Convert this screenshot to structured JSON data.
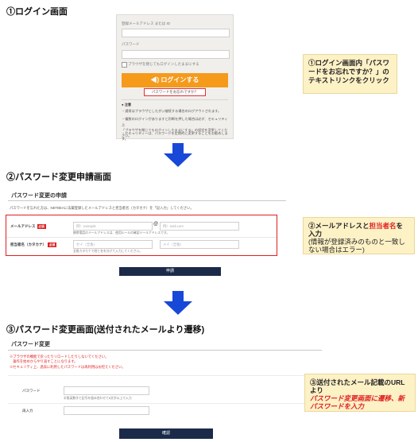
{
  "step1": {
    "title": "①ログイン画面",
    "login": {
      "email_label": "登録メールアドレス または ID",
      "password_label": "パスワード",
      "remember_label": "ブラウザを閉じてもログインしたままにする",
      "login_button": "◀) ログインする",
      "forgot_link": "パスワードをお忘れですか？",
      "notes_heading": "注意",
      "notes": [
        "・通常はブラウザとしたがい継続する場合のログアウトされます。",
        "・複数のログインがありますと判断を押した場合は必ず、セキュリティ上\n「ブラウザを閉じてもログインしたままにする」の設定を変更してください。",
        "・セキュリティーは、パスワードを定期的に変更することをお勧めします。"
      ]
    },
    "callout": "①ログイン画面内「パスワードをお忘れですか？」のテキストリンクをクリック"
  },
  "step2": {
    "title": "②パスワード変更申請画面",
    "heading": "パスワード変更の申請",
    "intro": "パスワードを忘れた方は、NETBEAに法薬登録したメールアドレスと担当者名（カタカナ）を「記入力」してください。",
    "email_label": "メールアドレス",
    "required": "必須",
    "email_placeholder1": "例）example",
    "at_sign": "@",
    "email_placeholder2": "例）mail.com",
    "email_hint": "携帯電話のメールアドレスは、使用ルールの確認メールアドレスです。",
    "name_label": "担当者名（カタカナ）",
    "last_name_placeholder": "セイ（全角）",
    "first_name_placeholder": "メイ（全角）",
    "name_hint": "全角カタカナで姓と名を分けて入力してください。",
    "submit": "申請",
    "callout": {
      "line1_a": "②メールアドレスと",
      "line1_red": "担当者名",
      "line1_b": "を入力",
      "line2": "(情報が登録済みのものと一致しない場合はエラー)"
    }
  },
  "step3": {
    "title": "③パスワード変更画面(送付されたメールより遷移)",
    "heading": "パスワード変更",
    "warnings": [
      "※ブラウザの機能で戻ったりリロードしたりしないでください。",
      "　操作を始めからやり直すことになります。",
      "※セキュリティ上、過去に利用したパスワードは再利用はお控えください。"
    ],
    "password_label": "パスワード",
    "password_hint": "半角英数字と記号を組み合わせて8文字以上で入力",
    "confirm_label": "再入力",
    "confirm_button": "確認",
    "callout": {
      "line1": "③送付されたメール記載のURLより",
      "line2_red": "パスワード変更画面に遷移、新パスワードを入力"
    }
  },
  "colors": {
    "accent_orange": "#f59a1b",
    "navy": "#1c2a4a",
    "arrow_blue": "#1848d8",
    "alert_red": "#e02020",
    "callout_bg": "#fdf1c6"
  }
}
